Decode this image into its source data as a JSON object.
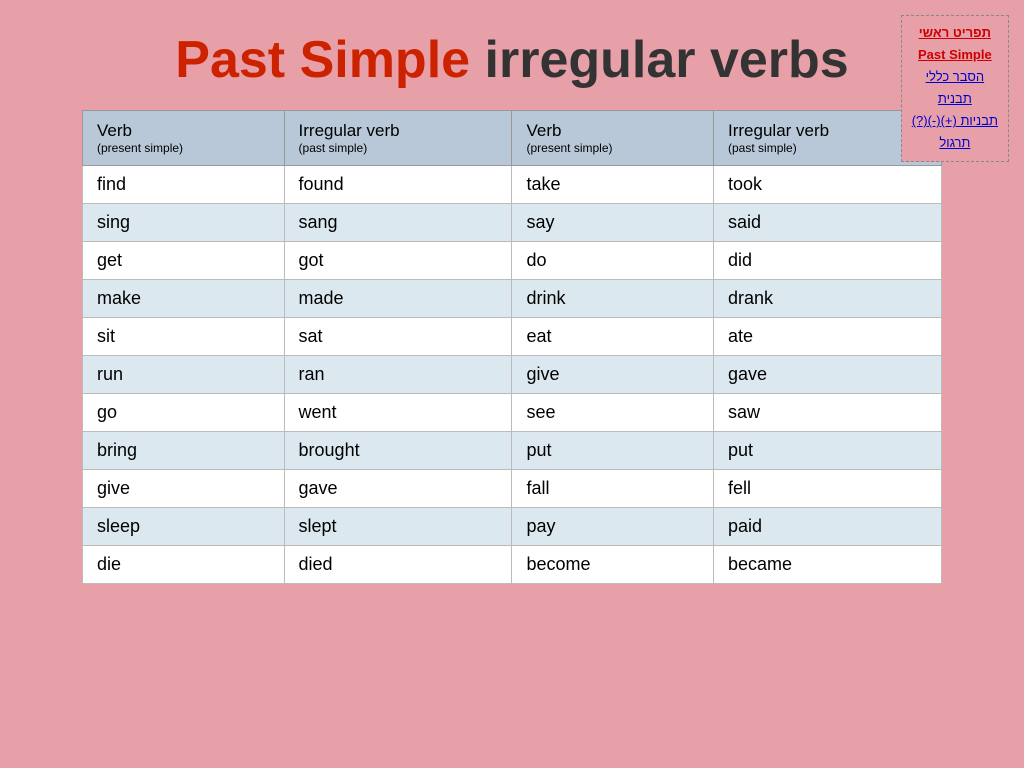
{
  "title": {
    "part1": "Past Simple",
    "part2": "irregular verbs"
  },
  "nav": {
    "links": [
      {
        "label": "תפריט ראשי",
        "active": false
      },
      {
        "label": "Past Simple",
        "active": true
      },
      {
        "label": "הסבר כללי",
        "active": false
      },
      {
        "label": "תבנית",
        "active": false
      },
      {
        "label": "תבניות (+)(-)(?) ",
        "active": false
      },
      {
        "label": "תרגול",
        "active": false
      }
    ]
  },
  "table": {
    "headers": [
      {
        "main": "Verb",
        "sub": "(present simple)"
      },
      {
        "main": "Irregular verb",
        "sub": "(past simple)"
      },
      {
        "main": "Verb",
        "sub": "(present simple)"
      },
      {
        "main": "Irregular verb",
        "sub": "(past simple)"
      }
    ],
    "rows": [
      [
        "find",
        "found",
        "take",
        "took"
      ],
      [
        "sing",
        "sang",
        "say",
        "said"
      ],
      [
        "get",
        "got",
        "do",
        "did"
      ],
      [
        "make",
        "made",
        "drink",
        "drank"
      ],
      [
        "sit",
        "sat",
        "eat",
        "ate"
      ],
      [
        "run",
        "ran",
        "give",
        "gave"
      ],
      [
        "go",
        "went",
        "see",
        "saw"
      ],
      [
        "bring",
        "brought",
        "put",
        "put"
      ],
      [
        "give",
        "gave",
        "fall",
        "fell"
      ],
      [
        "sleep",
        "slept",
        "pay",
        "paid"
      ],
      [
        "die",
        "died",
        "become",
        "became"
      ]
    ]
  }
}
